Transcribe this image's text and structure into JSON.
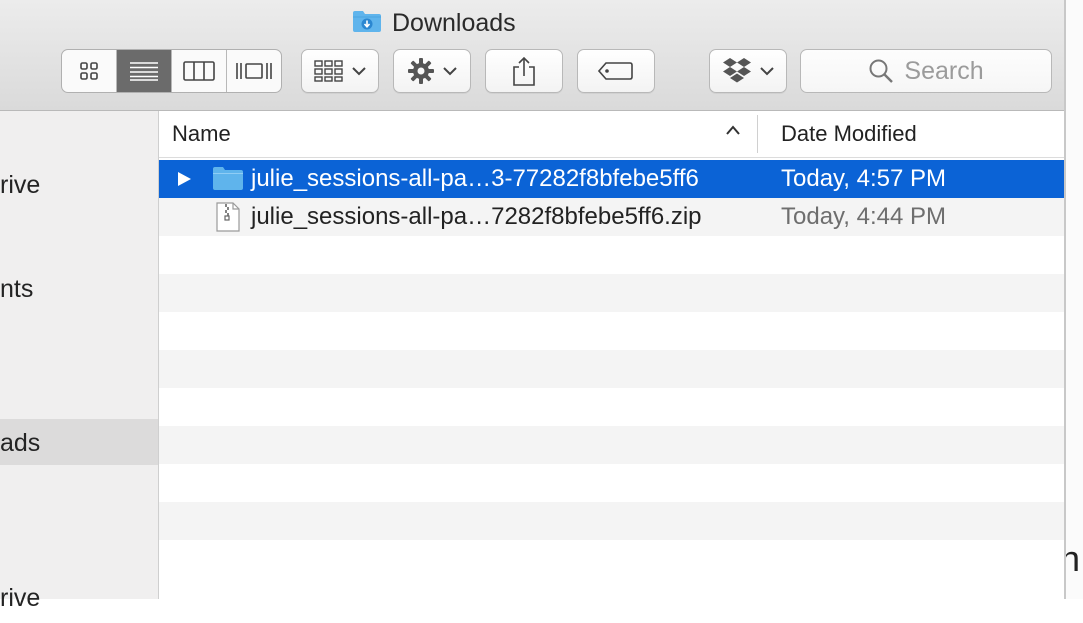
{
  "window": {
    "title": "Downloads"
  },
  "toolbar": {
    "view_modes": [
      "icon-view",
      "list-view",
      "column-view",
      "cover-flow-view"
    ],
    "active_view": "list-view"
  },
  "search": {
    "placeholder": "Search"
  },
  "sidebar": {
    "items": [
      {
        "label": "rive"
      },
      {
        "label": "nts"
      },
      {
        "label": "ads",
        "selected": true
      },
      {
        "label": "rive"
      }
    ]
  },
  "list": {
    "columns": {
      "name": "Name",
      "date_modified": "Date Modified"
    },
    "sort": "ascending",
    "rows": [
      {
        "name": "julie_sessions-all-pa…3-77282f8bfebe5ff6",
        "date": "Today, 4:57 PM",
        "kind": "folder",
        "selected": true
      },
      {
        "name": "julie_sessions-all-pa…7282f8bfebe5ff6.zip",
        "date": "Today, 4:44 PM",
        "kind": "zip",
        "selected": false
      }
    ],
    "empty_rows": 9
  },
  "colors": {
    "selection": "#0b63d6",
    "folder": "#5fb4ec"
  }
}
